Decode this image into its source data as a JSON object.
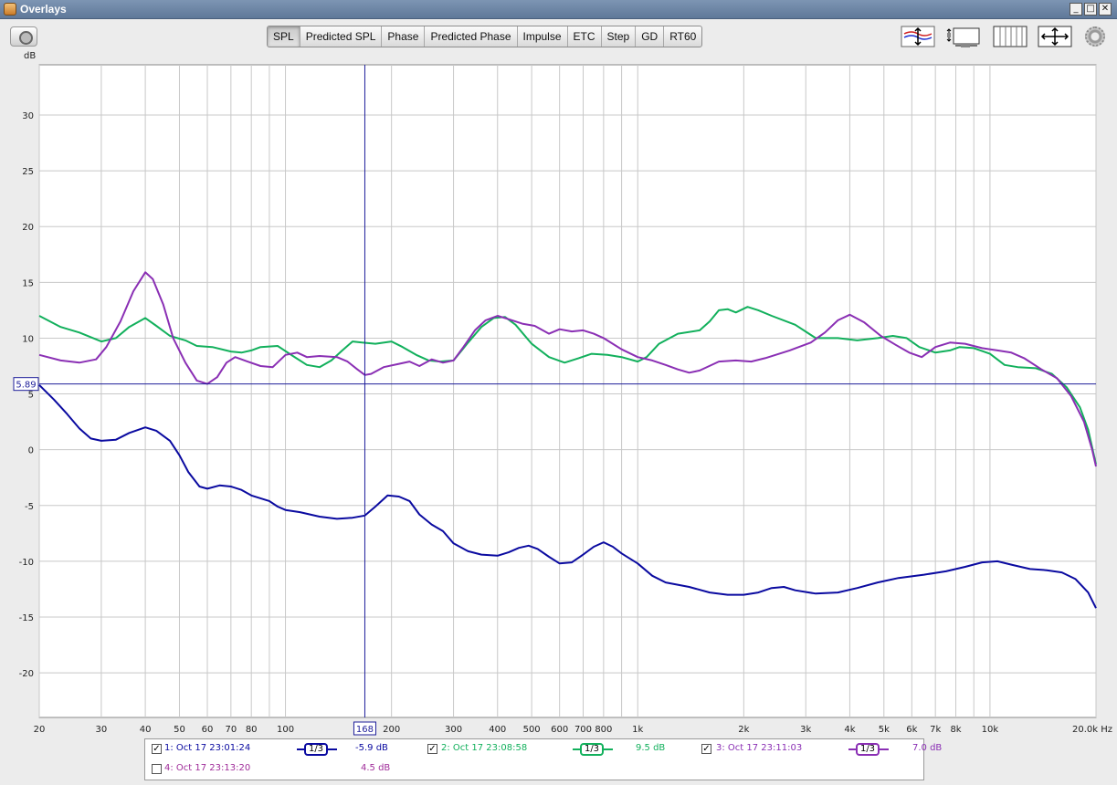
{
  "window": {
    "title": "Overlays",
    "buttons": {
      "minimize": "_",
      "maximize": "□",
      "close": "✕"
    }
  },
  "toolbar": {
    "tabs": [
      {
        "label": "SPL",
        "active": true
      },
      {
        "label": "Predicted SPL",
        "active": false
      },
      {
        "label": "Phase",
        "active": false
      },
      {
        "label": "Predicted Phase",
        "active": false
      },
      {
        "label": "Impulse",
        "active": false
      },
      {
        "label": "ETC",
        "active": false
      },
      {
        "label": "Step",
        "active": false
      },
      {
        "label": "GD",
        "active": false
      },
      {
        "label": "RT60",
        "active": false
      }
    ],
    "icons": [
      "camera-icon",
      "vertical-zoom-icon",
      "range-settings-icon",
      "grid-icon",
      "pan-arrows-icon",
      "gear-icon"
    ]
  },
  "colors": {
    "plot_bg": "#ffffff",
    "grid": "#c8c8c8",
    "cursor": "#1e1e9a",
    "series1": "#0a0aa0",
    "series2": "#12b05c",
    "series3": "#8a2fb4",
    "series4": "#a02d9a"
  },
  "chart_data": {
    "type": "line",
    "ylabel": "dB",
    "xlabel": "Hz",
    "x_scale": "log",
    "xlim": [
      20,
      20000
    ],
    "ylim": [
      -24,
      34.5
    ],
    "y_ticks": [
      30,
      25,
      20,
      15,
      10,
      5,
      0,
      -5,
      -10,
      -15,
      -20
    ],
    "x_ticks": [
      {
        "v": 20,
        "label": "20"
      },
      {
        "v": 30,
        "label": "30"
      },
      {
        "v": 40,
        "label": "40"
      },
      {
        "v": 50,
        "label": "50"
      },
      {
        "v": 60,
        "label": "60"
      },
      {
        "v": 70,
        "label": "70"
      },
      {
        "v": 80,
        "label": "80"
      },
      {
        "v": 100,
        "label": "100"
      },
      {
        "v": 200,
        "label": "200"
      },
      {
        "v": 300,
        "label": "300"
      },
      {
        "v": 400,
        "label": "400"
      },
      {
        "v": 500,
        "label": "500"
      },
      {
        "v": 600,
        "label": "600"
      },
      {
        "v": 700,
        "label": "700"
      },
      {
        "v": 800,
        "label": "800"
      },
      {
        "v": 1000,
        "label": "1k"
      },
      {
        "v": 2000,
        "label": "2k"
      },
      {
        "v": 3000,
        "label": "3k"
      },
      {
        "v": 4000,
        "label": "4k"
      },
      {
        "v": 5000,
        "label": "5k"
      },
      {
        "v": 6000,
        "label": "6k"
      },
      {
        "v": 7000,
        "label": "7k"
      },
      {
        "v": 8000,
        "label": "8k"
      },
      {
        "v": 10000,
        "label": "10k"
      },
      {
        "v": 20000,
        "label": "20.0k Hz"
      }
    ],
    "grid": true,
    "cursor": {
      "x": 168,
      "x_label": "168",
      "y": 5.89,
      "y_label": "5.89"
    },
    "series": [
      {
        "name": "1: Oct 17 23:01:24",
        "color": "#0a0aa0",
        "visible": true,
        "points": [
          [
            20,
            5.8
          ],
          [
            22,
            4.5
          ],
          [
            24,
            3.2
          ],
          [
            26,
            1.9
          ],
          [
            28,
            1.0
          ],
          [
            30,
            0.8
          ],
          [
            33,
            0.9
          ],
          [
            36,
            1.5
          ],
          [
            40,
            2.0
          ],
          [
            43,
            1.7
          ],
          [
            47,
            0.8
          ],
          [
            50,
            -0.5
          ],
          [
            53,
            -2.0
          ],
          [
            57,
            -3.3
          ],
          [
            60,
            -3.5
          ],
          [
            65,
            -3.2
          ],
          [
            70,
            -3.3
          ],
          [
            75,
            -3.6
          ],
          [
            80,
            -4.1
          ],
          [
            90,
            -4.6
          ],
          [
            95,
            -5.1
          ],
          [
            100,
            -5.4
          ],
          [
            110,
            -5.6
          ],
          [
            125,
            -6.0
          ],
          [
            140,
            -6.2
          ],
          [
            155,
            -6.1
          ],
          [
            168,
            -5.9
          ],
          [
            180,
            -5.1
          ],
          [
            195,
            -4.1
          ],
          [
            210,
            -4.2
          ],
          [
            225,
            -4.6
          ],
          [
            240,
            -5.8
          ],
          [
            260,
            -6.7
          ],
          [
            280,
            -7.3
          ],
          [
            300,
            -8.4
          ],
          [
            330,
            -9.1
          ],
          [
            360,
            -9.4
          ],
          [
            400,
            -9.5
          ],
          [
            430,
            -9.2
          ],
          [
            460,
            -8.8
          ],
          [
            490,
            -8.6
          ],
          [
            520,
            -8.9
          ],
          [
            560,
            -9.6
          ],
          [
            600,
            -10.2
          ],
          [
            650,
            -10.1
          ],
          [
            700,
            -9.4
          ],
          [
            750,
            -8.7
          ],
          [
            800,
            -8.3
          ],
          [
            850,
            -8.7
          ],
          [
            900,
            -9.3
          ],
          [
            1000,
            -10.2
          ],
          [
            1100,
            -11.3
          ],
          [
            1200,
            -11.9
          ],
          [
            1400,
            -12.3
          ],
          [
            1600,
            -12.8
          ],
          [
            1800,
            -13.0
          ],
          [
            2000,
            -13.0
          ],
          [
            2200,
            -12.8
          ],
          [
            2400,
            -12.4
          ],
          [
            2600,
            -12.3
          ],
          [
            2800,
            -12.6
          ],
          [
            3200,
            -12.9
          ],
          [
            3700,
            -12.8
          ],
          [
            4200,
            -12.4
          ],
          [
            4800,
            -11.9
          ],
          [
            5500,
            -11.5
          ],
          [
            6500,
            -11.2
          ],
          [
            7500,
            -10.9
          ],
          [
            8500,
            -10.5
          ],
          [
            9500,
            -10.1
          ],
          [
            10500,
            -10.0
          ],
          [
            11500,
            -10.3
          ],
          [
            13000,
            -10.7
          ],
          [
            14500,
            -10.8
          ],
          [
            16000,
            -11.0
          ],
          [
            17500,
            -11.6
          ],
          [
            19000,
            -12.8
          ],
          [
            20000,
            -14.2
          ]
        ]
      },
      {
        "name": "2: Oct 17 23:08:58",
        "color": "#12b05c",
        "visible": true,
        "points": [
          [
            20,
            12.0
          ],
          [
            23,
            11.0
          ],
          [
            26,
            10.5
          ],
          [
            30,
            9.7
          ],
          [
            33,
            10.0
          ],
          [
            36,
            11.0
          ],
          [
            40,
            11.8
          ],
          [
            43,
            11.1
          ],
          [
            47,
            10.2
          ],
          [
            52,
            9.8
          ],
          [
            56,
            9.3
          ],
          [
            62,
            9.2
          ],
          [
            70,
            8.8
          ],
          [
            75,
            8.7
          ],
          [
            80,
            8.9
          ],
          [
            85,
            9.2
          ],
          [
            95,
            9.3
          ],
          [
            105,
            8.4
          ],
          [
            115,
            7.6
          ],
          [
            125,
            7.4
          ],
          [
            135,
            8.0
          ],
          [
            145,
            8.9
          ],
          [
            155,
            9.7
          ],
          [
            165,
            9.6
          ],
          [
            180,
            9.5
          ],
          [
            200,
            9.7
          ],
          [
            215,
            9.2
          ],
          [
            235,
            8.5
          ],
          [
            255,
            8.0
          ],
          [
            275,
            7.9
          ],
          [
            300,
            8.0
          ],
          [
            330,
            9.6
          ],
          [
            360,
            11.0
          ],
          [
            390,
            11.8
          ],
          [
            420,
            11.9
          ],
          [
            450,
            11.2
          ],
          [
            500,
            9.5
          ],
          [
            560,
            8.3
          ],
          [
            620,
            7.8
          ],
          [
            680,
            8.2
          ],
          [
            740,
            8.6
          ],
          [
            820,
            8.5
          ],
          [
            900,
            8.3
          ],
          [
            1000,
            7.9
          ],
          [
            1060,
            8.3
          ],
          [
            1150,
            9.5
          ],
          [
            1300,
            10.4
          ],
          [
            1500,
            10.7
          ],
          [
            1600,
            11.5
          ],
          [
            1700,
            12.5
          ],
          [
            1800,
            12.6
          ],
          [
            1900,
            12.3
          ],
          [
            2050,
            12.8
          ],
          [
            2200,
            12.5
          ],
          [
            2400,
            12.0
          ],
          [
            2800,
            11.2
          ],
          [
            3200,
            10.0
          ],
          [
            3700,
            10.0
          ],
          [
            4200,
            9.8
          ],
          [
            4800,
            10.0
          ],
          [
            5300,
            10.2
          ],
          [
            5800,
            10.0
          ],
          [
            6300,
            9.2
          ],
          [
            7000,
            8.7
          ],
          [
            7700,
            8.9
          ],
          [
            8200,
            9.2
          ],
          [
            9000,
            9.1
          ],
          [
            10000,
            8.6
          ],
          [
            11000,
            7.6
          ],
          [
            12000,
            7.4
          ],
          [
            13500,
            7.3
          ],
          [
            15000,
            6.8
          ],
          [
            16500,
            5.6
          ],
          [
            18000,
            3.8
          ],
          [
            19000,
            1.8
          ],
          [
            20000,
            -1.3
          ]
        ]
      },
      {
        "name": "3: Oct 17 23:11:03",
        "color": "#8a2fb4",
        "visible": true,
        "points": [
          [
            20,
            8.5
          ],
          [
            23,
            8.0
          ],
          [
            26,
            7.8
          ],
          [
            29,
            8.1
          ],
          [
            31,
            9.2
          ],
          [
            34,
            11.5
          ],
          [
            37,
            14.2
          ],
          [
            40,
            15.9
          ],
          [
            42,
            15.3
          ],
          [
            45,
            13.0
          ],
          [
            48,
            10.0
          ],
          [
            52,
            7.8
          ],
          [
            56,
            6.2
          ],
          [
            60,
            5.9
          ],
          [
            64,
            6.5
          ],
          [
            68,
            7.8
          ],
          [
            72,
            8.3
          ],
          [
            78,
            7.9
          ],
          [
            85,
            7.5
          ],
          [
            92,
            7.4
          ],
          [
            100,
            8.5
          ],
          [
            108,
            8.7
          ],
          [
            115,
            8.3
          ],
          [
            125,
            8.4
          ],
          [
            140,
            8.3
          ],
          [
            150,
            7.9
          ],
          [
            160,
            7.2
          ],
          [
            168,
            6.7
          ],
          [
            175,
            6.8
          ],
          [
            190,
            7.4
          ],
          [
            210,
            7.7
          ],
          [
            225,
            7.9
          ],
          [
            240,
            7.5
          ],
          [
            260,
            8.1
          ],
          [
            280,
            7.8
          ],
          [
            300,
            8.0
          ],
          [
            320,
            9.2
          ],
          [
            345,
            10.7
          ],
          [
            370,
            11.6
          ],
          [
            400,
            12.0
          ],
          [
            430,
            11.7
          ],
          [
            470,
            11.3
          ],
          [
            510,
            11.1
          ],
          [
            560,
            10.4
          ],
          [
            600,
            10.8
          ],
          [
            650,
            10.6
          ],
          [
            700,
            10.7
          ],
          [
            750,
            10.4
          ],
          [
            800,
            10.0
          ],
          [
            900,
            9.0
          ],
          [
            1000,
            8.3
          ],
          [
            1100,
            8.0
          ],
          [
            1200,
            7.6
          ],
          [
            1300,
            7.2
          ],
          [
            1400,
            6.9
          ],
          [
            1500,
            7.1
          ],
          [
            1700,
            7.9
          ],
          [
            1900,
            8.0
          ],
          [
            2100,
            7.9
          ],
          [
            2300,
            8.2
          ],
          [
            2700,
            8.9
          ],
          [
            3100,
            9.6
          ],
          [
            3400,
            10.5
          ],
          [
            3700,
            11.6
          ],
          [
            4000,
            12.1
          ],
          [
            4400,
            11.4
          ],
          [
            4900,
            10.2
          ],
          [
            5400,
            9.4
          ],
          [
            5900,
            8.7
          ],
          [
            6400,
            8.3
          ],
          [
            7000,
            9.2
          ],
          [
            7700,
            9.6
          ],
          [
            8500,
            9.5
          ],
          [
            9500,
            9.1
          ],
          [
            10500,
            8.9
          ],
          [
            11500,
            8.7
          ],
          [
            12500,
            8.2
          ],
          [
            14000,
            7.2
          ],
          [
            15500,
            6.4
          ],
          [
            17000,
            4.8
          ],
          [
            18500,
            2.5
          ],
          [
            19500,
            0.0
          ],
          [
            20000,
            -1.5
          ]
        ]
      },
      {
        "name": "4: Oct 17 23:13:20",
        "color": "#a02d9a",
        "visible": false,
        "points": []
      }
    ]
  },
  "legend": [
    {
      "checked": true,
      "check_mark": "✓",
      "name": "1: Oct 17 23:01:24",
      "smoothing": "1/3",
      "value": "-5.9 dB",
      "color": "#0a0aa0"
    },
    {
      "checked": true,
      "check_mark": "✓",
      "name": "2: Oct 17 23:08:58",
      "smoothing": "1/3",
      "value": "9.5 dB",
      "color": "#12b05c"
    },
    {
      "checked": true,
      "check_mark": "✓",
      "name": "3: Oct 17 23:11:03",
      "smoothing": "1/3",
      "value": "7.0 dB",
      "color": "#8a2fb4"
    },
    {
      "checked": false,
      "check_mark": "",
      "name": "4: Oct 17 23:13:20",
      "smoothing": "",
      "value": "4.5 dB",
      "color": "#a02d9a"
    }
  ]
}
